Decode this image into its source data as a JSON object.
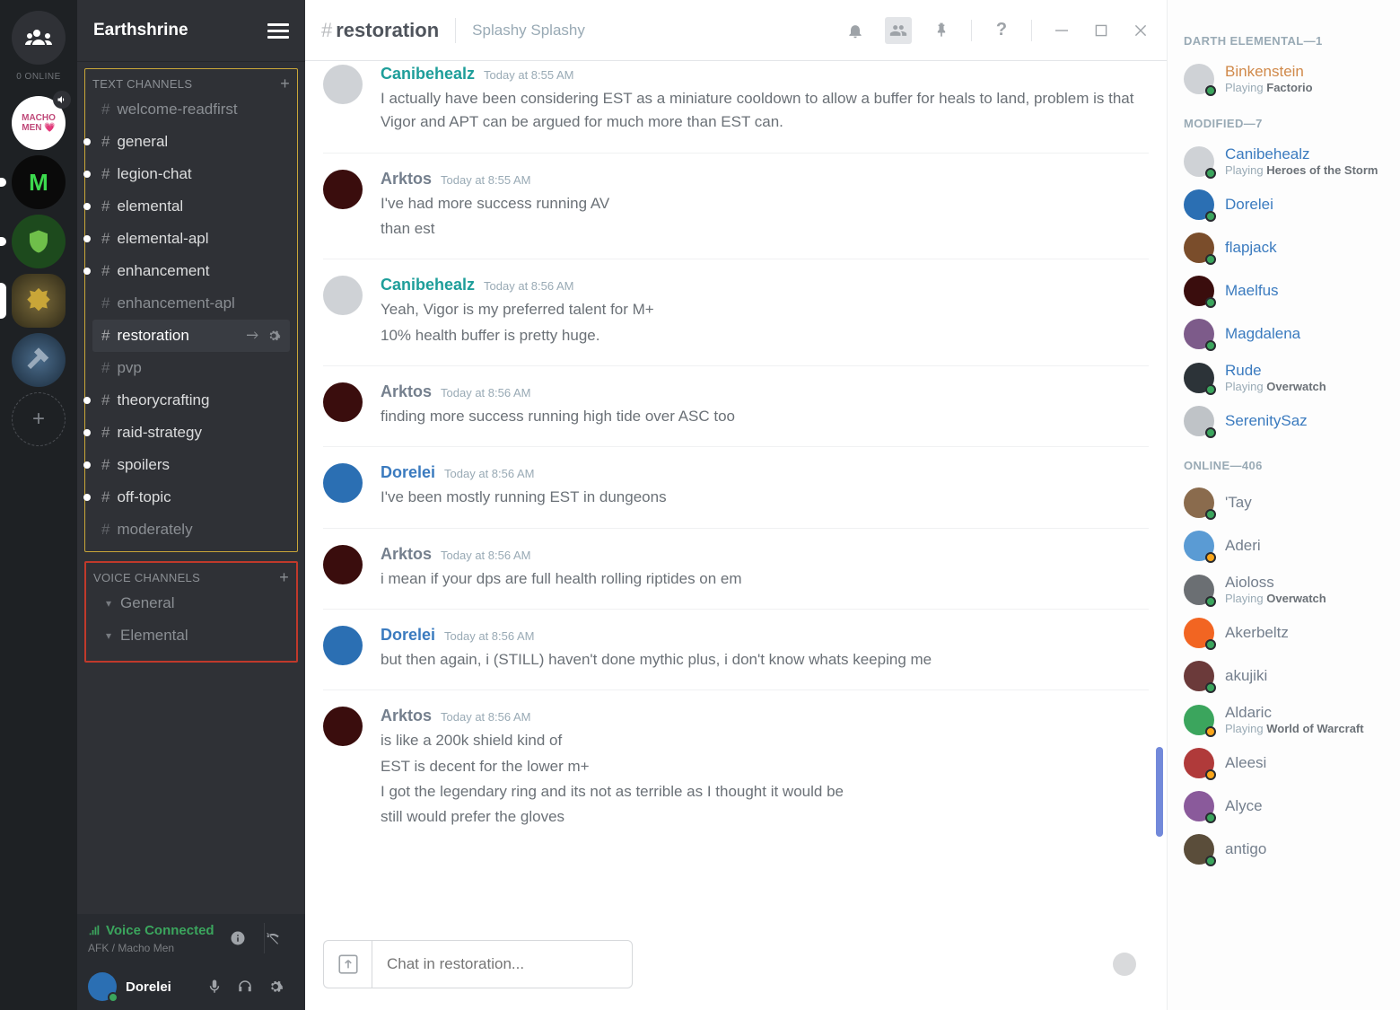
{
  "rail": {
    "online_label": "0 ONLINE",
    "servers": [
      "home",
      "MACHO MEN",
      "M",
      "tree",
      "crest",
      "hammer"
    ]
  },
  "server_name": "Earthshrine",
  "text_channels_label": "TEXT CHANNELS",
  "voice_channels_label": "VOICE CHANNELS",
  "text_channels": [
    {
      "name": "welcome-readfirst",
      "bright": false
    },
    {
      "name": "general",
      "bright": true
    },
    {
      "name": "legion-chat",
      "bright": true
    },
    {
      "name": "elemental",
      "bright": true
    },
    {
      "name": "elemental-apl",
      "bright": true
    },
    {
      "name": "enhancement",
      "bright": true
    },
    {
      "name": "enhancement-apl",
      "bright": false
    },
    {
      "name": "restoration",
      "bright": true,
      "selected": true
    },
    {
      "name": "pvp",
      "bright": false
    },
    {
      "name": "theorycrafting",
      "bright": true
    },
    {
      "name": "raid-strategy",
      "bright": true
    },
    {
      "name": "spoilers",
      "bright": true
    },
    {
      "name": "off-topic",
      "bright": true
    },
    {
      "name": "moderately",
      "bright": false
    }
  ],
  "voice_channels": [
    {
      "name": "General"
    },
    {
      "name": "Elemental"
    }
  ],
  "voice_status": {
    "title": "Voice Connected",
    "sub": "AFK / Macho Men"
  },
  "user": {
    "name": "Dorelei"
  },
  "channel_header": {
    "hash": "#",
    "name": "restoration",
    "topic": "Splashy Splashy"
  },
  "messages": [
    {
      "author": "Canibehealz",
      "color": "c-teal",
      "time": "Today at 8:55 AM",
      "avatar": "#cfd2d6",
      "lines": [
        "I actually have been considering EST as a miniature cooldown to allow a buffer for heals to land, problem is that Vigor and APT can be argued for much more than EST can."
      ]
    },
    {
      "author": "Arktos",
      "color": "c-gray",
      "time": "Today at 8:55 AM",
      "avatar": "#3a0d0d",
      "lines": [
        "I've had more success running AV",
        "than est"
      ]
    },
    {
      "author": "Canibehealz",
      "color": "c-teal",
      "time": "Today at 8:56 AM",
      "avatar": "#cfd2d6",
      "lines": [
        "Yeah, Vigor is my preferred talent for M+",
        "10% health buffer is pretty huge."
      ]
    },
    {
      "author": "Arktos",
      "color": "c-gray",
      "time": "Today at 8:56 AM",
      "avatar": "#3a0d0d",
      "lines": [
        "finding more success running high tide over ASC too"
      ]
    },
    {
      "author": "Dorelei",
      "color": "c-blue",
      "time": "Today at 8:56 AM",
      "avatar": "#2b6fb3",
      "lines": [
        "I've been mostly running EST in dungeons"
      ]
    },
    {
      "author": "Arktos",
      "color": "c-gray",
      "time": "Today at 8:56 AM",
      "avatar": "#3a0d0d",
      "lines": [
        "i mean if your dps are full health rolling riptides on em"
      ]
    },
    {
      "author": "Dorelei",
      "color": "c-blue",
      "time": "Today at 8:56 AM",
      "avatar": "#2b6fb3",
      "lines": [
        "but then again, i (STILL) haven't done mythic plus, i don't know whats keeping me"
      ]
    },
    {
      "author": "Arktos",
      "color": "c-gray",
      "time": "Today at 8:56 AM",
      "avatar": "#3a0d0d",
      "lines": [
        "is like a 200k shield kind of",
        "EST is decent for the lower m+",
        "I got the legendary ring and its not as terrible as I thought it would be",
        "still would prefer the gloves"
      ]
    }
  ],
  "input_placeholder": "Chat in restoration...",
  "member_groups": [
    {
      "title": "DARTH ELEMENTAL—1",
      "members": [
        {
          "name": "Binkenstein",
          "color": "c-orange",
          "status": "online",
          "playing": "Factorio",
          "avatar": "#cfd2d6"
        }
      ]
    },
    {
      "title": "MODIFIED—7",
      "members": [
        {
          "name": "Canibehealz",
          "color": "c-blue",
          "status": "online",
          "playing": "Heroes of the Storm",
          "avatar": "#cfd2d6"
        },
        {
          "name": "Dorelei",
          "color": "c-blue",
          "status": "online",
          "avatar": "#2b6fb3"
        },
        {
          "name": "flapjack",
          "color": "c-blue",
          "status": "online",
          "avatar": "#7a4d2b"
        },
        {
          "name": "Maelfus",
          "color": "c-blue",
          "status": "online",
          "avatar": "#3a0d0d"
        },
        {
          "name": "Magdalena",
          "color": "c-blue",
          "status": "online",
          "avatar": "#7d5b8a"
        },
        {
          "name": "Rude",
          "color": "c-blue",
          "status": "online",
          "playing": "Overwatch",
          "avatar": "#2c3338"
        },
        {
          "name": "SerenitySaz",
          "color": "c-blue",
          "status": "online",
          "avatar": "#bfc3c7"
        }
      ]
    },
    {
      "title": "ONLINE—406",
      "members": [
        {
          "name": "'Tay",
          "color": "c-gray",
          "status": "online",
          "avatar": "#8a6b4d"
        },
        {
          "name": "Aderi",
          "color": "c-gray",
          "status": "idle",
          "avatar": "#5a9bd4"
        },
        {
          "name": "Aioloss",
          "color": "c-gray",
          "status": "online",
          "playing": "Overwatch",
          "avatar": "#6b6f73"
        },
        {
          "name": "Akerbeltz",
          "color": "c-gray",
          "status": "online",
          "avatar": "#f26522"
        },
        {
          "name": "akujiki",
          "color": "c-gray",
          "status": "online",
          "avatar": "#6b3a3a"
        },
        {
          "name": "Aldaric",
          "color": "c-gray",
          "status": "idle",
          "playing": "World of Warcraft",
          "avatar": "#3ba55d"
        },
        {
          "name": "Aleesi",
          "color": "c-gray",
          "status": "idle",
          "avatar": "#b03a3a"
        },
        {
          "name": "Alyce",
          "color": "c-gray",
          "status": "online",
          "avatar": "#8a5a9b"
        },
        {
          "name": "antigo",
          "color": "c-gray",
          "status": "online",
          "avatar": "#5a4d3a"
        }
      ]
    }
  ],
  "playing_label": "Playing"
}
